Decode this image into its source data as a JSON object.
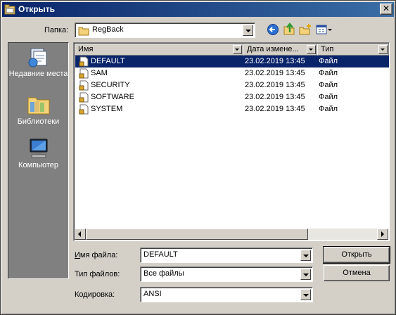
{
  "window": {
    "title": "Открыть",
    "close_glyph": "✕"
  },
  "toolbar": {
    "folder_label": "Папка:",
    "folder_value": "RegBack",
    "icons": [
      "back-icon",
      "up-folder-icon",
      "new-folder-icon",
      "view-menu-icon"
    ]
  },
  "places": [
    {
      "label": "Недавние места",
      "icon": "recent-places-icon"
    },
    {
      "label": "Библиотеки",
      "icon": "libraries-icon"
    },
    {
      "label": "Компьютер",
      "icon": "computer-icon"
    }
  ],
  "columns": {
    "name": "Имя",
    "date": "Дата измене...",
    "type": "Тип"
  },
  "files": [
    {
      "name": "DEFAULT",
      "date": "23.02.2019 13:45",
      "type": "Файл",
      "selected": true
    },
    {
      "name": "SAM",
      "date": "23.02.2019 13:45",
      "type": "Файл",
      "selected": false
    },
    {
      "name": "SECURITY",
      "date": "23.02.2019 13:45",
      "type": "Файл",
      "selected": false
    },
    {
      "name": "SOFTWARE",
      "date": "23.02.2019 13:45",
      "type": "Файл",
      "selected": false
    },
    {
      "name": "SYSTEM",
      "date": "23.02.2019 13:45",
      "type": "Файл",
      "selected": false
    }
  ],
  "form": {
    "filename_label": "Имя файла:",
    "filename_value": "DEFAULT",
    "filetype_label": "Тип файлов:",
    "filetype_value": "Все файлы",
    "encoding_label": "Кодировка:",
    "encoding_value": "ANSI"
  },
  "buttons": {
    "open": "Открыть",
    "cancel": "Отмена"
  },
  "colors": {
    "title_start": "#0a246a",
    "title_end": "#3a6ea5",
    "selection": "#0a246a",
    "face": "#d4d0c8"
  }
}
